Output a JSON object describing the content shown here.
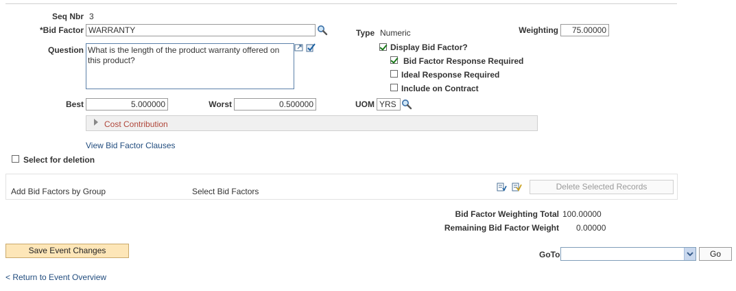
{
  "seq": {
    "label": "Seq Nbr",
    "value": "3"
  },
  "bid_factor": {
    "label": "*Bid Factor",
    "value": "WARRANTY"
  },
  "type": {
    "label": "Type",
    "value": "Numeric"
  },
  "weighting": {
    "label": "Weighting",
    "value": "75.00000"
  },
  "question": {
    "label": "Question",
    "value": "What is the length of the product warranty offered on this product?"
  },
  "checkboxes": {
    "display_bid_factor": "Display Bid Factor?",
    "response_required": "Bid Factor Response Required",
    "ideal_required": "Ideal Response Required",
    "include_contract": "Include on Contract",
    "select_deletion": "Select for deletion"
  },
  "best": {
    "label": "Best",
    "value": "5.000000"
  },
  "worst": {
    "label": "Worst",
    "value": "0.500000"
  },
  "uom": {
    "label": "UOM",
    "value": "YRS"
  },
  "cost_contribution": "Cost Contribution",
  "view_clauses": "View Bid Factor Clauses",
  "toolbar": {
    "add_by_group": "Add Bid Factors by Group",
    "select_factors": "Select Bid Factors",
    "delete_selected": "Delete Selected Records"
  },
  "totals": {
    "weighting_total_label": "Bid Factor Weighting Total",
    "weighting_total_value": "100.00000",
    "remaining_label": "Remaining Bid Factor Weight",
    "remaining_value": "0.00000"
  },
  "save_button": "Save Event Changes",
  "goto": {
    "label": "GoTo",
    "value": "",
    "go_button": "Go"
  },
  "return_link": "< Return to Event Overview",
  "colors": {
    "link": "#214c7e",
    "collapsible_title": "#b0463a",
    "save_button_bg": "#fde6b8"
  }
}
